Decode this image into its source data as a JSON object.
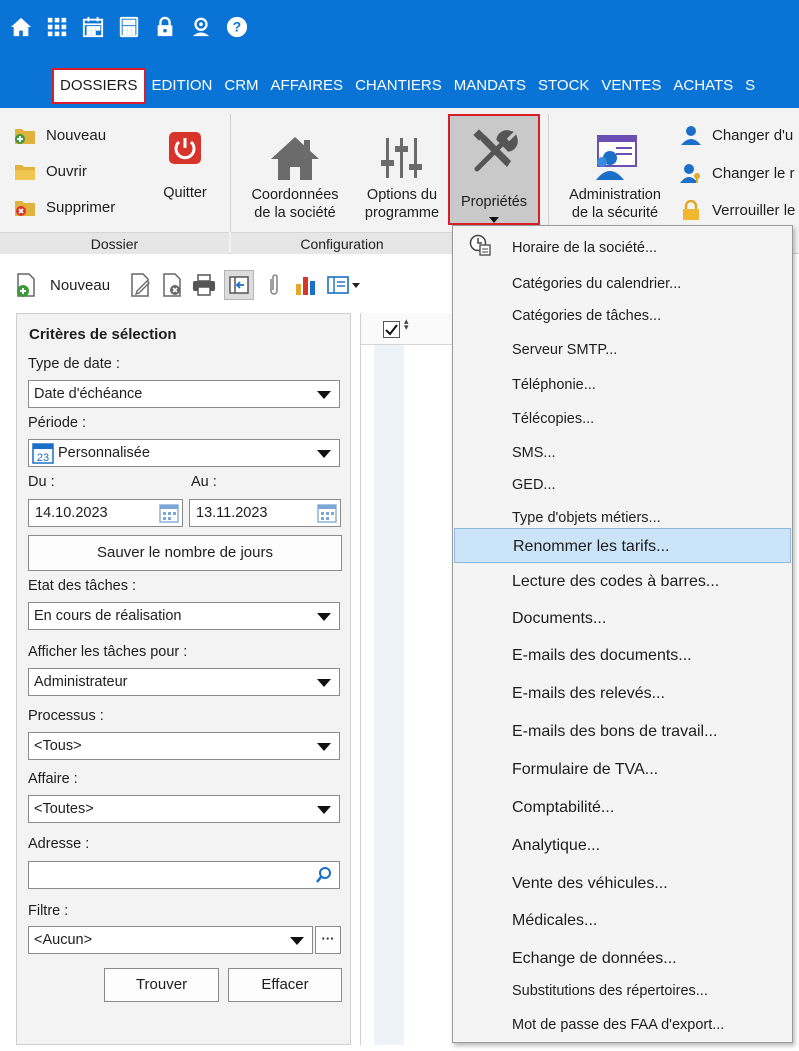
{
  "colors": {
    "topbar": "#0a74d6",
    "highlight_border": "#d81e2a",
    "menu_hover": "#cce4f7"
  },
  "quick_icons": [
    "home-icon",
    "apps-icon",
    "calendar-icon",
    "calculator-icon",
    "lock-icon",
    "user-icon",
    "help-icon"
  ],
  "menu": [
    "DOSSIERS",
    "EDITION",
    "CRM",
    "AFFAIRES",
    "CHANTIERS",
    "MANDATS",
    "STOCK",
    "VENTES",
    "ACHATS",
    "S"
  ],
  "ribbon": {
    "dossier": {
      "nouveau": "Nouveau",
      "ouvrir": "Ouvrir",
      "supprimer": "Supprimer",
      "quitter": "Quitter",
      "group": "Dossier"
    },
    "configuration": {
      "coordonnees_1": "Coordonnées",
      "coordonnees_2": "de la société",
      "options_1": "Options du",
      "options_2": "programme",
      "proprietes": "Propriétés",
      "group": "Configuration"
    },
    "securite": {
      "admin_1": "Administration",
      "admin_2": "de la sécurité",
      "changer_u": "Changer d'u",
      "changer_l": "Changer le r",
      "verrouiller": "Verrouiller le"
    }
  },
  "toolbar": {
    "nouveau": "Nouveau"
  },
  "criteria": {
    "title": "Critères de sélection",
    "type_date_label": "Type de date :",
    "type_date_value": "Date d'échéance",
    "periode_label": "Période :",
    "periode_value": "Personnalisée",
    "du_label": "Du :",
    "au_label": "Au :",
    "du_value": "14.10.2023",
    "au_value": "13.11.2023",
    "sauver_button": "Sauver le nombre de jours",
    "etat_label": "Etat des tâches :",
    "etat_value": "En cours de réalisation",
    "afficher_label": "Afficher les tâches pour :",
    "afficher_value": "Administrateur",
    "processus_label": "Processus :",
    "processus_value": "<Tous>",
    "affaire_label": "Affaire :",
    "affaire_value": "<Toutes>",
    "adresse_label": "Adresse :",
    "adresse_value": "",
    "filtre_label": "Filtre :",
    "filtre_value": "<Aucun>",
    "more_button": "···",
    "trouver_button": "Trouver",
    "effacer_button": "Effacer"
  },
  "popup": {
    "items": [
      "Horaire de la société...",
      "Catégories du calendrier...",
      "Catégories de tâches...",
      "Serveur SMTP...",
      "Téléphonie...",
      "Télécopies...",
      "SMS...",
      "GED...",
      "Type d'objets métiers...",
      "Renommer les tarifs...",
      "Lecture des codes à barres...",
      "Documents...",
      "E-mails des documents...",
      "E-mails des relevés...",
      "E-mails des bons de travail...",
      "Formulaire de TVA...",
      "Comptabilité...",
      "Analytique...",
      "Vente des véhicules...",
      "Médicales...",
      "Echange de données...",
      "Substitutions des répertoires...",
      "Mot de passe des FAA d'export..."
    ],
    "highlighted": "Renommer les tarifs..."
  }
}
